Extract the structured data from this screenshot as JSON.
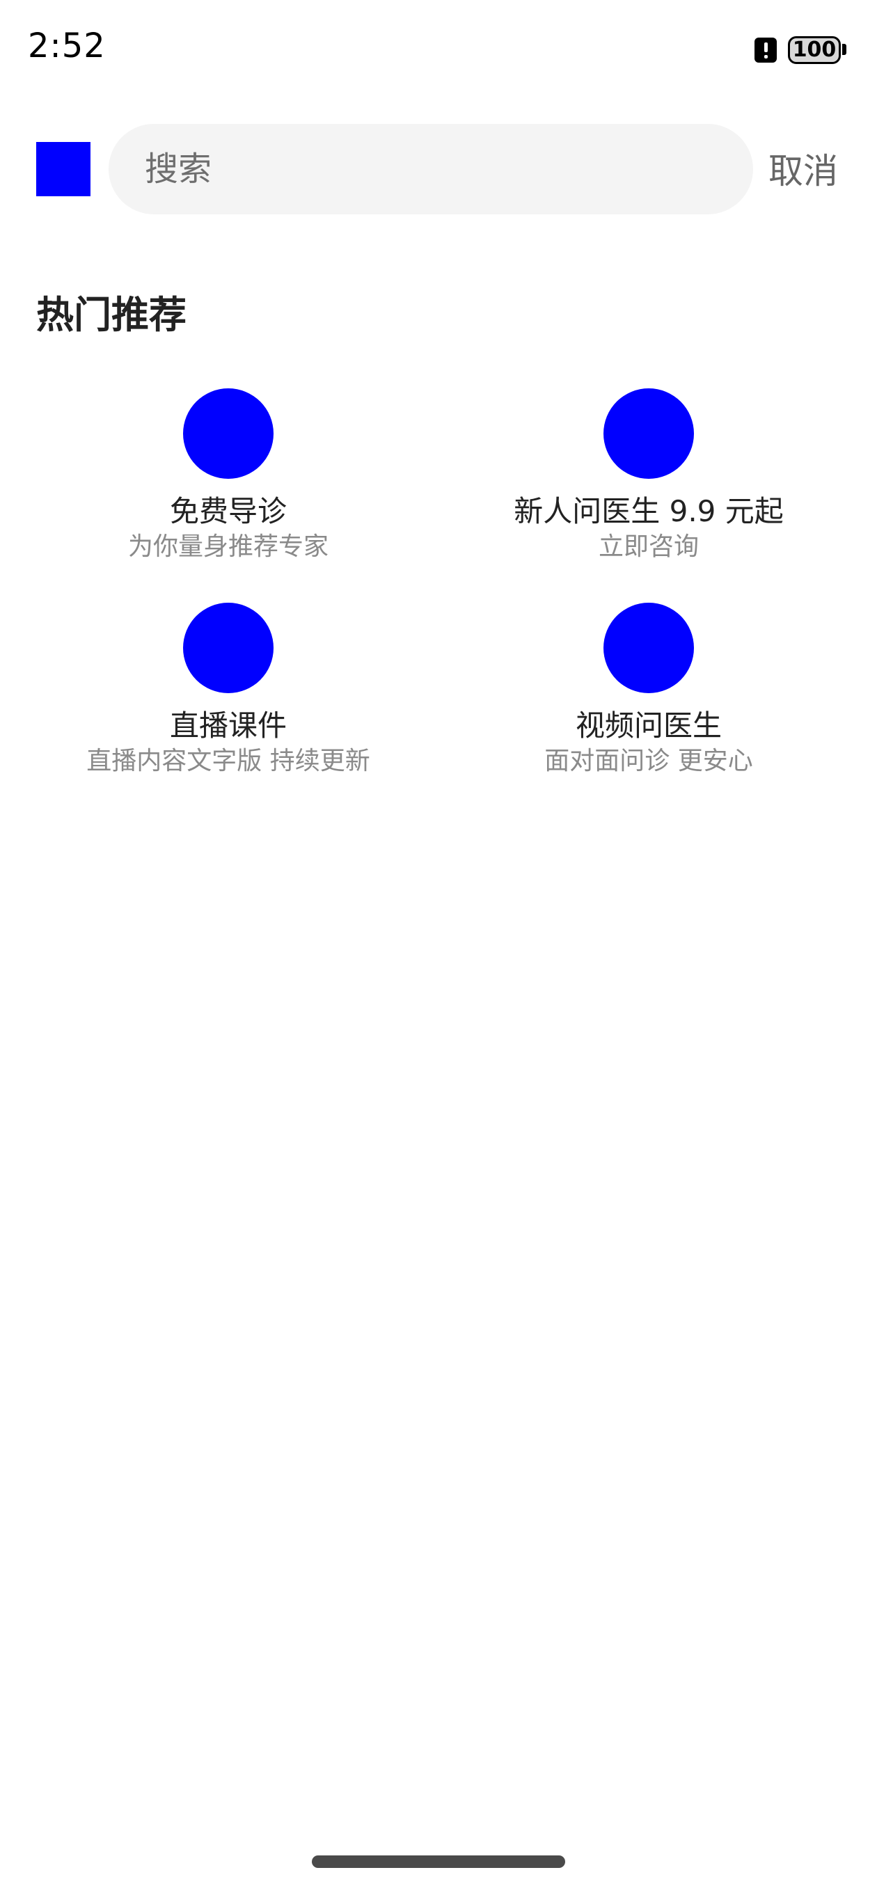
{
  "status_bar": {
    "time": "2:52",
    "alert_icon": "alert-icon",
    "battery_level": "100"
  },
  "search": {
    "placeholder": "搜索",
    "cancel_label": "取消"
  },
  "section": {
    "title": "热门推荐"
  },
  "recommendations": [
    {
      "title": "免费导诊",
      "subtitle": "为你量身推荐专家",
      "icon": "blue-circle-icon"
    },
    {
      "title": "新人问医生 9.9 元起",
      "subtitle": "立即咨询",
      "icon": "blue-circle-icon"
    },
    {
      "title": "直播课件",
      "subtitle": "直播内容文字版 持续更新",
      "icon": "blue-circle-icon"
    },
    {
      "title": "视频问医生",
      "subtitle": "面对面问诊 更安心",
      "icon": "blue-circle-icon"
    }
  ],
  "colors": {
    "accent": "#0000ff",
    "background": "#ffffff",
    "search_bg": "#f4f4f4",
    "title_text": "#222222",
    "subtitle_text": "#8a8a8a"
  }
}
